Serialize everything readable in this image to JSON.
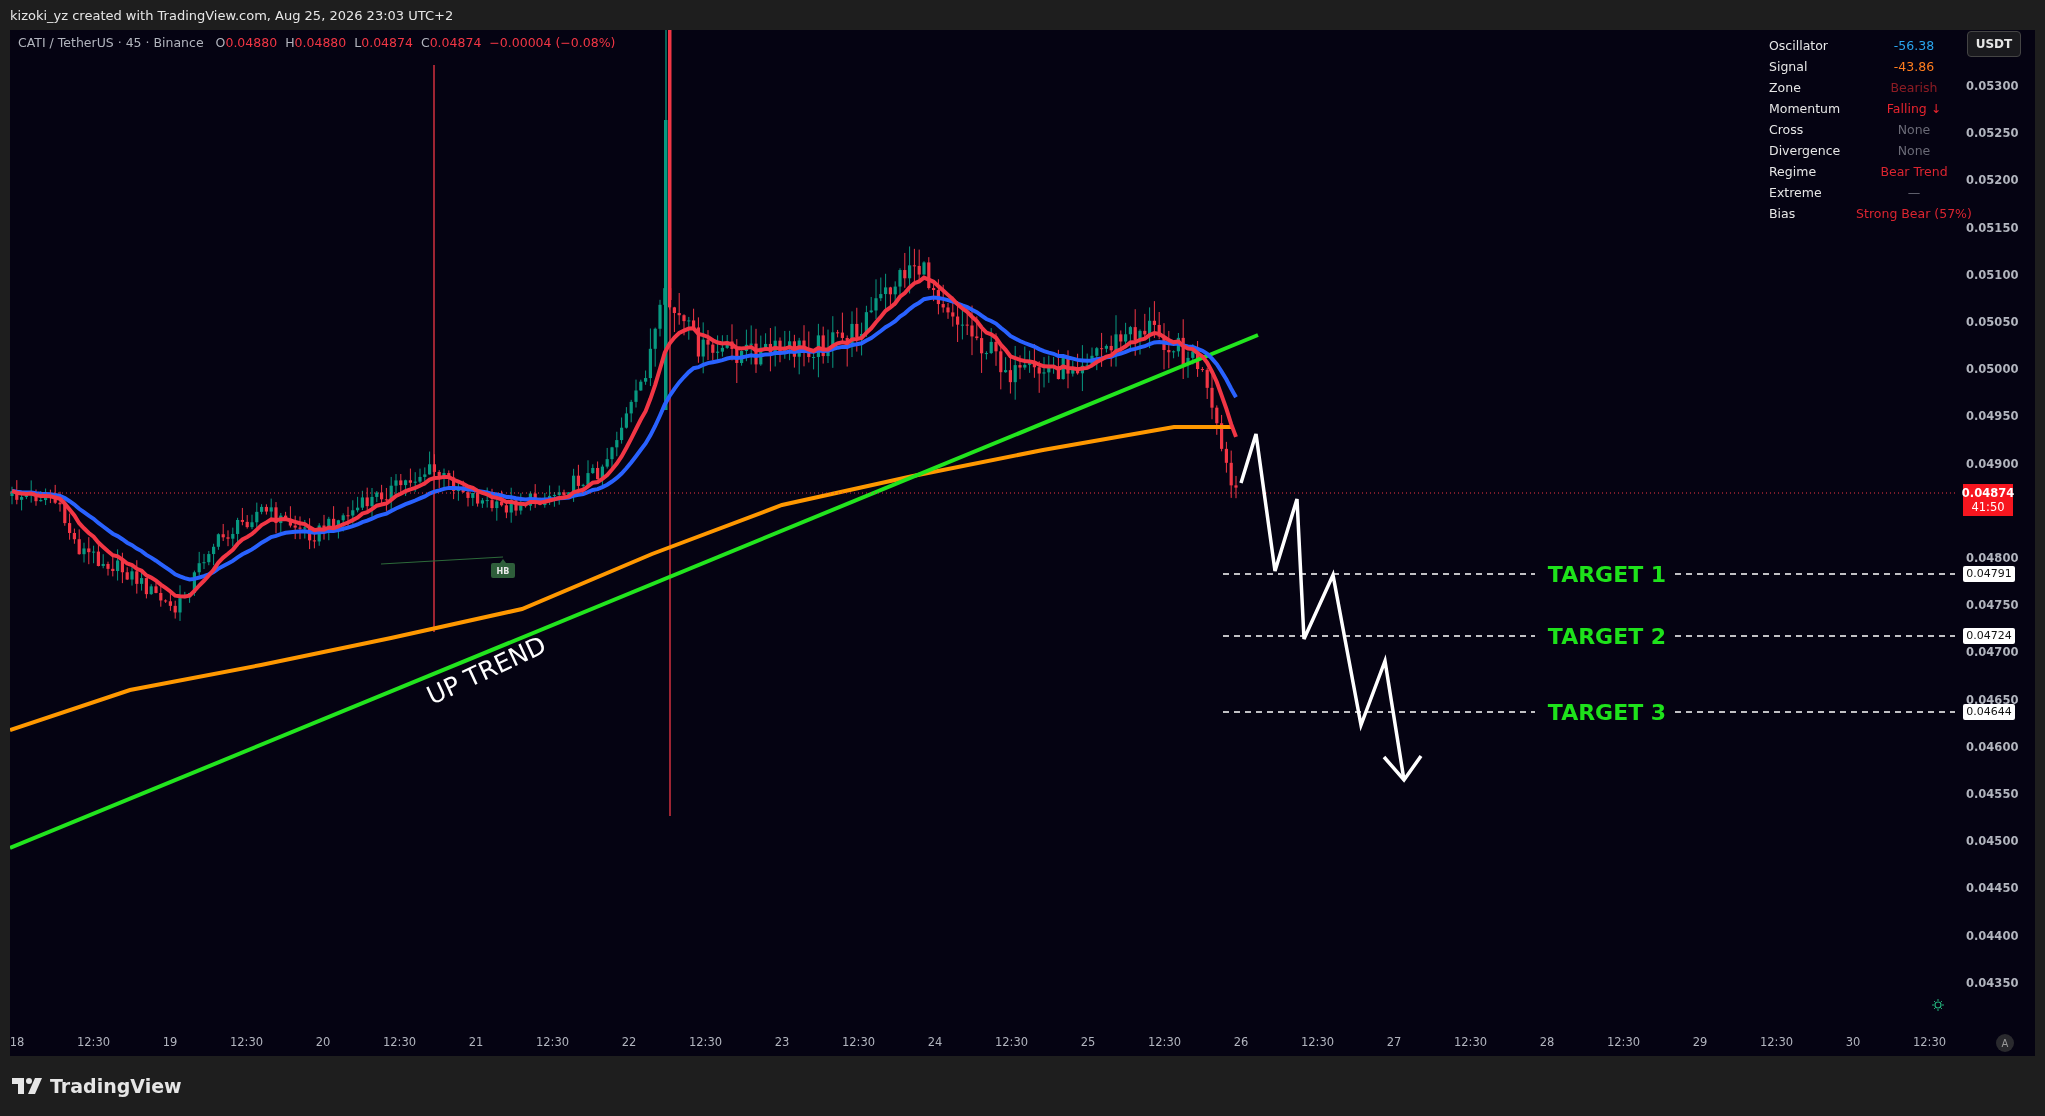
{
  "header": {
    "attribution": "kizoki_yz created with TradingView.com, Aug 25, 2026 23:03 UTC+2"
  },
  "legend": {
    "symbol": "CATI / TetherUS · 45 · Binance",
    "ohlc": [
      {
        "label": "O",
        "value": "0.04880"
      },
      {
        "label": "H",
        "value": "0.04880"
      },
      {
        "label": "L",
        "value": "0.04874"
      },
      {
        "label": "C",
        "value": "0.04874"
      }
    ],
    "change": "−0.00004 (−0.08%)"
  },
  "indicator_table": [
    {
      "label": "Oscillator",
      "value": "-56.38",
      "color": "#2aa4ec"
    },
    {
      "label": "Signal",
      "value": "-43.86",
      "color": "#ff7d1e"
    },
    {
      "label": "Zone",
      "value": "Bearish",
      "color": "#8e1c24"
    },
    {
      "label": "Momentum",
      "value": "Falling ↓",
      "color": "#e8242e"
    },
    {
      "label": "Cross",
      "value": "None",
      "color": "#6a6a76"
    },
    {
      "label": "Divergence",
      "value": "None",
      "color": "#6a6a76"
    },
    {
      "label": "Regime",
      "value": "Bear Trend",
      "color": "#dc2530"
    },
    {
      "label": "Extreme",
      "value": "—",
      "color": "#6a6a76"
    },
    {
      "label": "Bias",
      "value": "Strong Bear (57%)",
      "color": "#dc2530"
    }
  ],
  "currency_button": "USDT",
  "chart": {
    "annotation": "UP TREND",
    "marker": "HB",
    "targets": [
      {
        "label": "TARGET 1",
        "price": "0.04791"
      },
      {
        "label": "TARGET 2",
        "price": "0.04724"
      },
      {
        "label": "TARGET 3",
        "price": "0.04644"
      }
    ]
  },
  "price_axis": {
    "ticks": [
      "0.05300",
      "0.05250",
      "0.05200",
      "0.05150",
      "0.05100",
      "0.05050",
      "0.05000",
      "0.04950",
      "0.04900",
      "0.04800",
      "0.04750",
      "0.04700",
      "0.04650",
      "0.04600",
      "0.04550",
      "0.04500",
      "0.04450",
      "0.04400",
      "0.04350"
    ],
    "last_price": "0.04874",
    "countdown": "41:50"
  },
  "time_axis": {
    "ticks": [
      "18",
      "12:30",
      "19",
      "12:30",
      "20",
      "12:30",
      "21",
      "12:30",
      "22",
      "12:30",
      "23",
      "12:30",
      "24",
      "12:30",
      "25",
      "12:30",
      "26",
      "12:30",
      "27",
      "12:30",
      "28",
      "12:30",
      "29",
      "12:30",
      "30",
      "12:30"
    ]
  },
  "auto_scale_button": "A",
  "footer": {
    "logo_text": "TradingView"
  }
}
